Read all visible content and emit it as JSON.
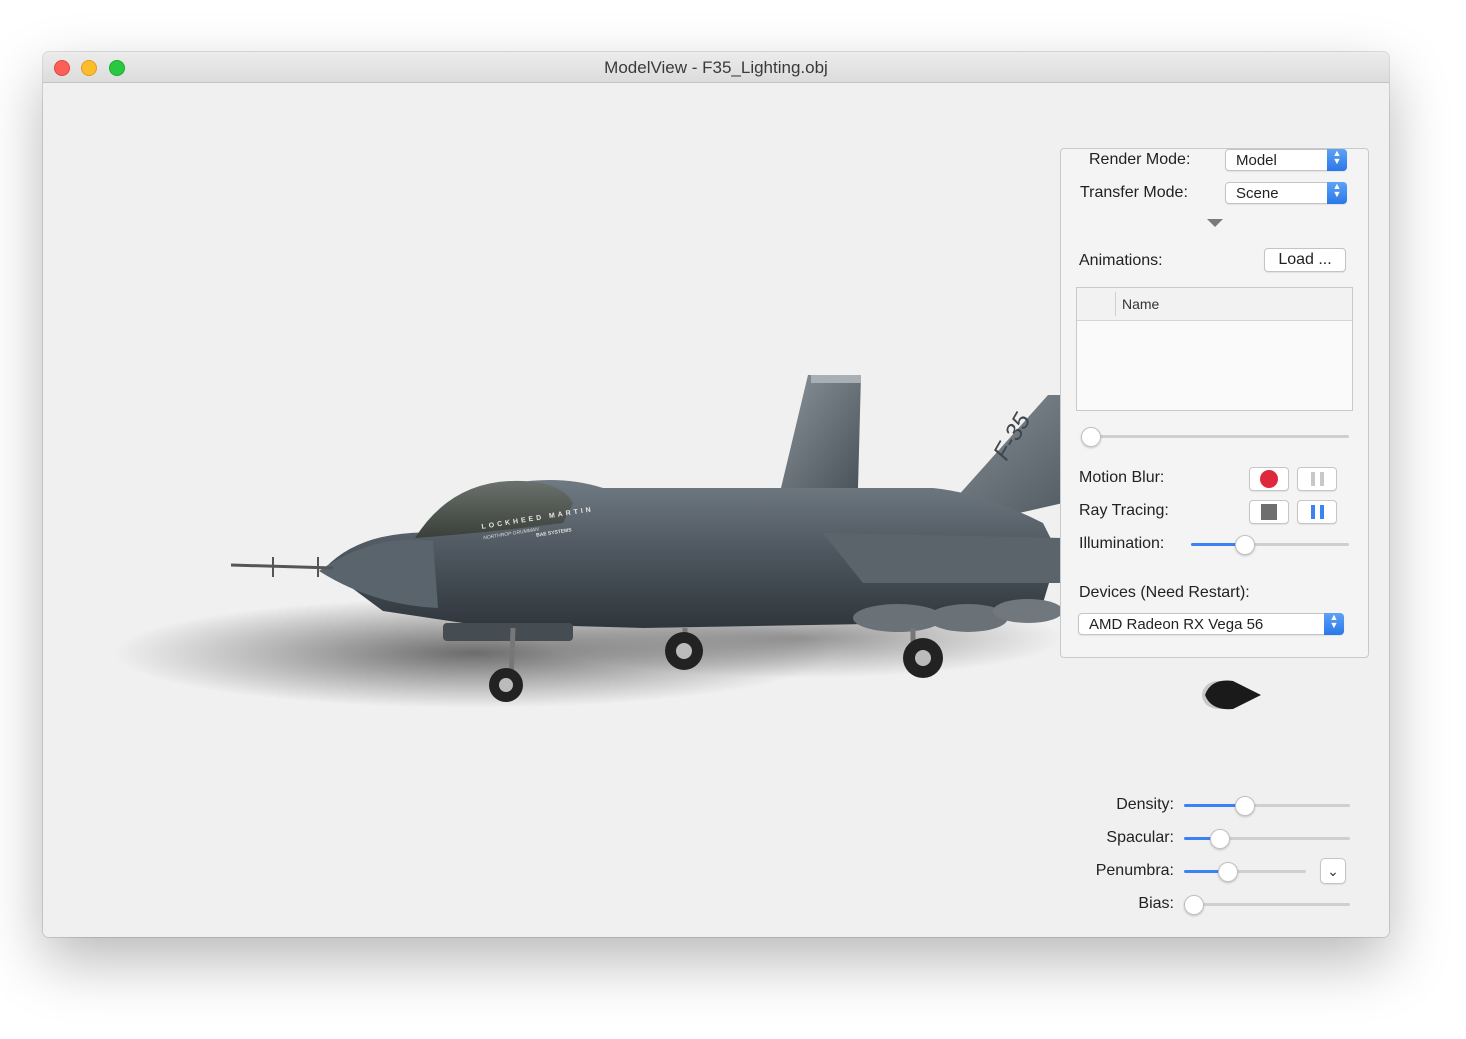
{
  "window": {
    "title": "ModelView - F35_Lighting.obj"
  },
  "panel": {
    "render_mode": {
      "label": "Render Mode:",
      "value": "Model"
    },
    "transfer_mode": {
      "label": "Transfer Mode:",
      "value": "Scene"
    },
    "animations": {
      "label": "Animations:",
      "load_button": "Load ..."
    },
    "table": {
      "columns": [
        "",
        "Name"
      ],
      "rows": []
    },
    "animation_progress": 0,
    "motion_blur": {
      "label": "Motion Blur:"
    },
    "ray_tracing": {
      "label": "Ray Tracing:"
    },
    "illumination": {
      "label": "Illumination:",
      "value": 0.32
    },
    "devices": {
      "label": "Devices (Need Restart):",
      "value": "AMD Radeon RX Vega 56"
    }
  },
  "bottom_controls": {
    "density": {
      "label": "Density:",
      "value": 0.35
    },
    "spacular": {
      "label": "Spacular:",
      "value": 0.18
    },
    "penumbra": {
      "label": "Penumbra:",
      "value": 0.33
    },
    "bias": {
      "label": "Bias:",
      "value": 0.0
    }
  },
  "icons": {
    "close": "close-icon",
    "minimize": "minimize-icon",
    "zoom": "zoom-icon",
    "record": "record-icon",
    "pause": "pause-icon",
    "stop": "stop-icon",
    "disclosure": "disclosure-triangle-icon",
    "light_blob": "light-source-icon",
    "chevron": "chevron-down-icon"
  },
  "colors": {
    "accent": "#3b82f6",
    "record": "#e0283c",
    "window_bg": "#efefef"
  },
  "fuselage_text": [
    "LOCKHEED MARTIN",
    "NORTHROP GRUMMAN",
    "BAE SYSTEMS",
    "F-35"
  ]
}
